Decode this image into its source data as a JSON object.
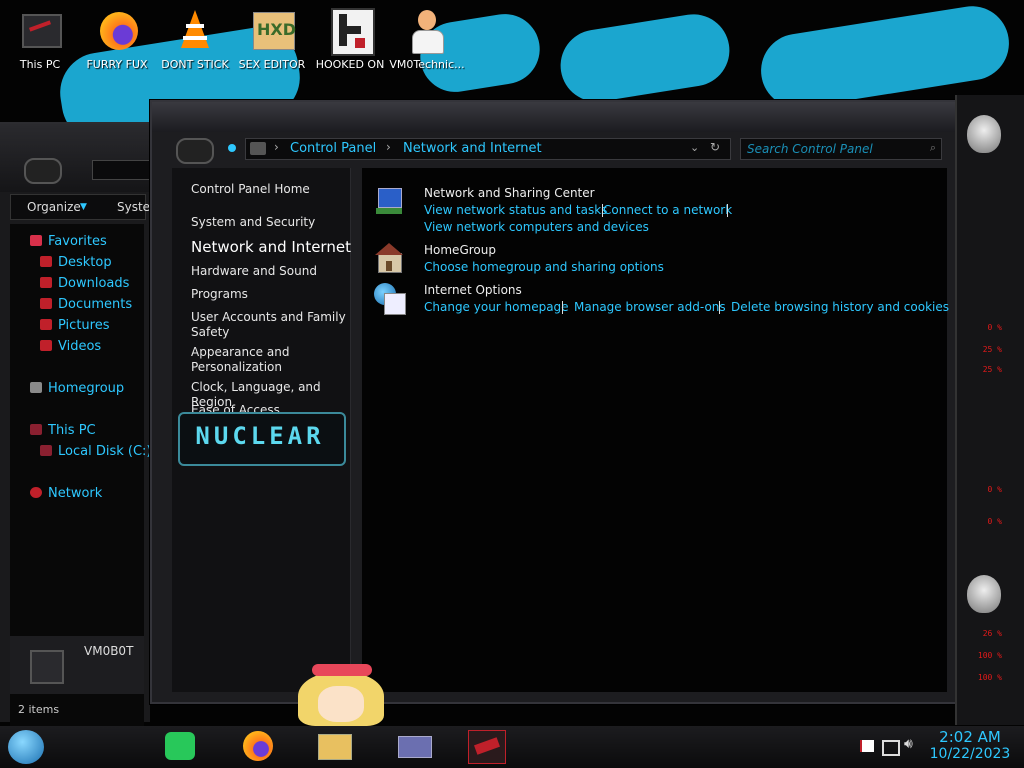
{
  "desktop": {
    "icons": [
      {
        "label": "This PC",
        "icon": "this-pc-icon"
      },
      {
        "label": "FURRY FUX",
        "icon": "firefox-icon"
      },
      {
        "label": "DONT STICK",
        "icon": "vlc-icon"
      },
      {
        "label": "SEX EDITOR",
        "icon": "hxd-editor-icon"
      },
      {
        "label": "HOOKED ON",
        "icon": "hooked-app-icon"
      },
      {
        "label": "VM0Technic...",
        "icon": "doctor-user-icon"
      }
    ]
  },
  "explorer": {
    "organize": "Organize",
    "system": "Syste",
    "nav": [
      {
        "label": "Favorites",
        "icon": "favorites-icon"
      },
      {
        "label": "Desktop",
        "icon": "desktop-folder-icon"
      },
      {
        "label": "Downloads",
        "icon": "downloads-folder-icon"
      },
      {
        "label": "Documents",
        "icon": "documents-folder-icon"
      },
      {
        "label": "Pictures",
        "icon": "pictures-folder-icon"
      },
      {
        "label": "Videos",
        "icon": "videos-folder-icon"
      },
      {
        "label": "Homegroup",
        "icon": "homegroup-icon"
      },
      {
        "label": "This PC",
        "icon": "this-pc-icon"
      },
      {
        "label": "Local Disk (C:)",
        "icon": "local-disk-icon"
      },
      {
        "label": "Network",
        "icon": "network-icon"
      }
    ],
    "computer_name": "VM0B0T",
    "status": "2 items"
  },
  "control_panel": {
    "breadcrumb": [
      "Control Panel",
      "Network and Internet"
    ],
    "search_placeholder": "Search Control Panel",
    "left_links": [
      "Control Panel Home",
      "System and Security",
      "Network and Internet",
      "Hardware and Sound",
      "Programs",
      "User Accounts and Family Safety",
      "Appearance and Personalization",
      "Clock, Language, and Region",
      "Ease of Access"
    ],
    "sections": [
      {
        "title": "Network and Sharing Center",
        "icon": "network-sharing-center-icon",
        "tasks": [
          "View network status and tasks",
          "Connect to a network",
          "View network computers and devices"
        ]
      },
      {
        "title": "HomeGroup",
        "icon": "homegroup-house-icon",
        "tasks": [
          "Choose homegroup and sharing options"
        ]
      },
      {
        "title": "Internet Options",
        "icon": "internet-options-globe-icon",
        "tasks": [
          "Change your homepage",
          "Manage browser add-ons",
          "Delete browsing history and cookies"
        ]
      }
    ],
    "banner": "NUCLEAR"
  },
  "hud": {
    "values": [
      "0 %",
      "25 %",
      "25 %",
      "0 %",
      "0 %",
      "26 %",
      "100 %",
      "100 %"
    ]
  },
  "taskbar": {
    "time": "2:02 AM",
    "date": "10/22/2023"
  }
}
